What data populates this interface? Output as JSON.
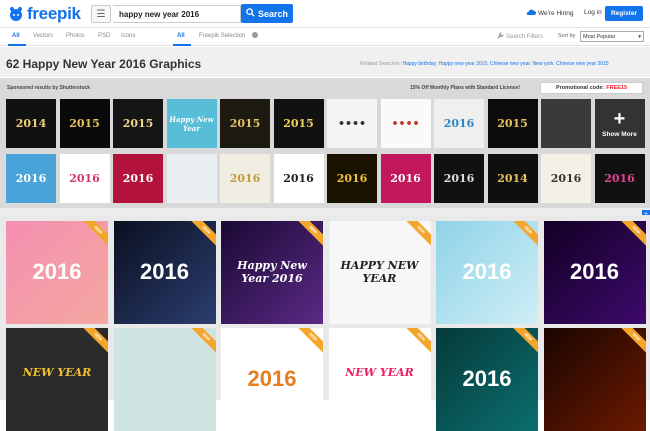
{
  "header": {
    "logo_text": "freepik",
    "search_value": "happy new year 2016",
    "search_button": "Search",
    "hiring": "We're Hiring",
    "login": "Log in",
    "register": "Register"
  },
  "tabs": {
    "left": [
      "All",
      "Vectors",
      "Photos",
      "PSD",
      "Icons"
    ],
    "right": [
      "All",
      "Freepik Selection"
    ],
    "search_filters": "Search Filters",
    "sort_by_label": "Sort by",
    "sort_selected": "Most Popular"
  },
  "page_title": "62 Happy New Year 2016 Graphics",
  "related": {
    "label": "Related Searches:",
    "links": [
      "Happy birthday",
      "Happy new year 2015",
      "Chinese new year",
      "New york",
      "Chinese new year 2015"
    ]
  },
  "sponsored": {
    "label": "Sponsored results by Shutterstock",
    "promo_text": "15% Off Monthly Plans with Standard License!",
    "promo_label": "Promotional code:",
    "promo_code": "FREE15",
    "show_more": "Show More",
    "row1": [
      {
        "text": "2014",
        "bg": "#111",
        "fg": "#f1d27a"
      },
      {
        "text": "2015",
        "bg": "#0a0a0a",
        "fg": "#e8c35b"
      },
      {
        "text": "2015",
        "bg": "#151515",
        "fg": "#f0d58c"
      },
      {
        "text": "Happy New Year",
        "bg": "#58bdd6",
        "fg": "#ffffff"
      },
      {
        "text": "2015",
        "bg": "#1d1a12",
        "fg": "#e6c066"
      },
      {
        "text": "2015",
        "bg": "#111",
        "fg": "#f2cf5a"
      },
      {
        "text": "••••",
        "bg": "#f4f4f4",
        "fg": "#333"
      },
      {
        "text": "••••",
        "bg": "#fafafa",
        "fg": "#c0392b"
      },
      {
        "text": "2016",
        "bg": "#efefef",
        "fg": "#2e84c5"
      },
      {
        "text": "2015",
        "bg": "#0c0c0c",
        "fg": "#e8c35b"
      },
      {
        "text": "",
        "bg": "#3a3a3a",
        "fg": "#cccccc"
      },
      {
        "text": "",
        "bg": "#b81c1c",
        "fg": "#f5c842"
      }
    ],
    "row2": [
      {
        "text": "2016",
        "bg": "#4aa3d9",
        "fg": "#ffffff"
      },
      {
        "text": "2016",
        "bg": "#ffffff",
        "fg": "#d6336c"
      },
      {
        "text": "2016",
        "bg": "#b3123a",
        "fg": "#ffffff"
      },
      {
        "text": "",
        "bg": "#e9eef2",
        "fg": "#999"
      },
      {
        "text": "2016",
        "bg": "#f0ede3",
        "fg": "#c49a3a"
      },
      {
        "text": "2016",
        "bg": "#ffffff",
        "fg": "#222"
      },
      {
        "text": "2016",
        "bg": "#1a1200",
        "fg": "#f0c040"
      },
      {
        "text": "2016",
        "bg": "#c2185b",
        "fg": "#ffffff"
      },
      {
        "text": "2016",
        "bg": "#111",
        "fg": "#dddddd"
      },
      {
        "text": "2014",
        "bg": "#0f0f0f",
        "fg": "#e8c35b"
      },
      {
        "text": "2016",
        "bg": "#f4f0e6",
        "fg": "#333"
      },
      {
        "text": "2016",
        "bg": "#111",
        "fg": "#e84393"
      }
    ]
  },
  "cards_row1": [
    {
      "text": "2016",
      "bg": "linear-gradient(135deg,#f48fb1,#f4a7a0)",
      "fg": "#ffffff"
    },
    {
      "text": "2016",
      "bg": "linear-gradient(135deg,#0b1020,#2c3e70)",
      "fg": "#ffffff"
    },
    {
      "text": "Happy New Year 2016",
      "bg": "linear-gradient(135deg,#1a0933,#5b2a86)",
      "fg": "#ffffff"
    },
    {
      "text": "HAPPY NEW YEAR",
      "bg": "#f7f7f7",
      "fg": "#222"
    },
    {
      "text": "2016",
      "bg": "linear-gradient(135deg,#8fd3e8,#cfeef5)",
      "fg": "#ffffff"
    },
    {
      "text": "2016",
      "bg": "linear-gradient(135deg,#120024,#3d0a6b)",
      "fg": "#ffffff"
    }
  ],
  "cards_row2": [
    {
      "text": "NEW YEAR",
      "bg": "#2b2b2b",
      "fg": "#f2c12e"
    },
    {
      "text": "",
      "bg": "#cfe3e1",
      "fg": "#c0392b"
    },
    {
      "text": "2016",
      "bg": "#ffffff",
      "fg": "#e67e22"
    },
    {
      "text": "NEW YEAR",
      "bg": "#ffffff",
      "fg": "#e91e63"
    },
    {
      "text": "2016",
      "bg": "linear-gradient(135deg,#063a3a,#0b6e6e)",
      "fg": "#ffffff"
    },
    {
      "text": "",
      "bg": "linear-gradient(135deg,#1a0500,#6b1a00)",
      "fg": "#f39c12"
    }
  ],
  "badge": "NEW",
  "colors": {
    "brand": "#1273eb",
    "promo_code": "#e8212f",
    "ribbon": "#f4a52b"
  }
}
